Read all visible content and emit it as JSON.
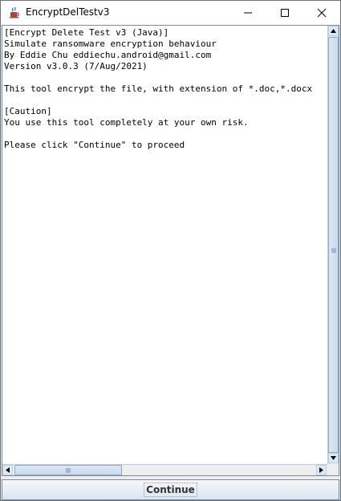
{
  "window": {
    "title": "EncryptDelTestv3",
    "icon": "java-cup-icon",
    "controls": [
      "minimize-icon",
      "maximize-icon",
      "close-icon"
    ]
  },
  "content": {
    "lines": [
      "[Encrypt Delete Test v3 (Java)]",
      "Simulate ransomware encryption behaviour",
      "By Eddie Chu eddiechu.android@gmail.com",
      "Version v3.0.3 (7/Aug/2021)",
      "",
      "This tool encrypt the file, with extension of *.doc,*.docx",
      "",
      "[Caution]",
      "You use this tool completely at your own risk.",
      "",
      "Please click \"Continue\" to proceed"
    ]
  },
  "footer": {
    "continue_label": "Continue"
  },
  "colors": {
    "scroll_track": "#eeeeee",
    "scroll_thumb": "#c9dbee",
    "scroll_border": "#8fa9c6"
  }
}
